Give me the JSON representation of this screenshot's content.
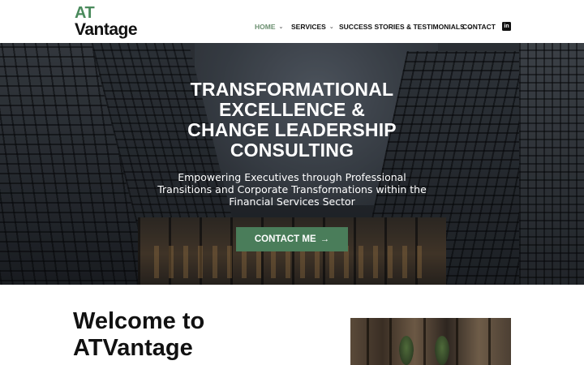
{
  "logo": {
    "top": "AT",
    "bottom": "Vantage"
  },
  "nav": {
    "items": [
      {
        "label": "HOME",
        "dropdown": true,
        "active": true
      },
      {
        "label": "SERVICES",
        "dropdown": true,
        "active": false
      },
      {
        "label": "SUCCESS STORIES & TESTIMONIALS",
        "dropdown": true,
        "active": false
      },
      {
        "label": "CONTACT",
        "dropdown": false,
        "active": false
      }
    ],
    "social_icon": "linkedin-icon",
    "social_glyph": "in"
  },
  "hero": {
    "title_lines": [
      "TRANSFORMATIONAL",
      "EXCELLENCE &",
      "CHANGE LEADERSHIP",
      "CONSULTING"
    ],
    "subtitle_lines": [
      "Empowering Executives through Professional",
      "Transitions and Corporate Transformations within the",
      "Financial Services Sector"
    ],
    "cta_label": "CONTACT ME",
    "cta_icon": "arrow-right-icon"
  },
  "welcome": {
    "line1": "Welcome to",
    "line2": "ATVantage"
  },
  "colors": {
    "accent": "#4a7d5a",
    "active_nav": "#6b8f70",
    "text": "#111111"
  }
}
